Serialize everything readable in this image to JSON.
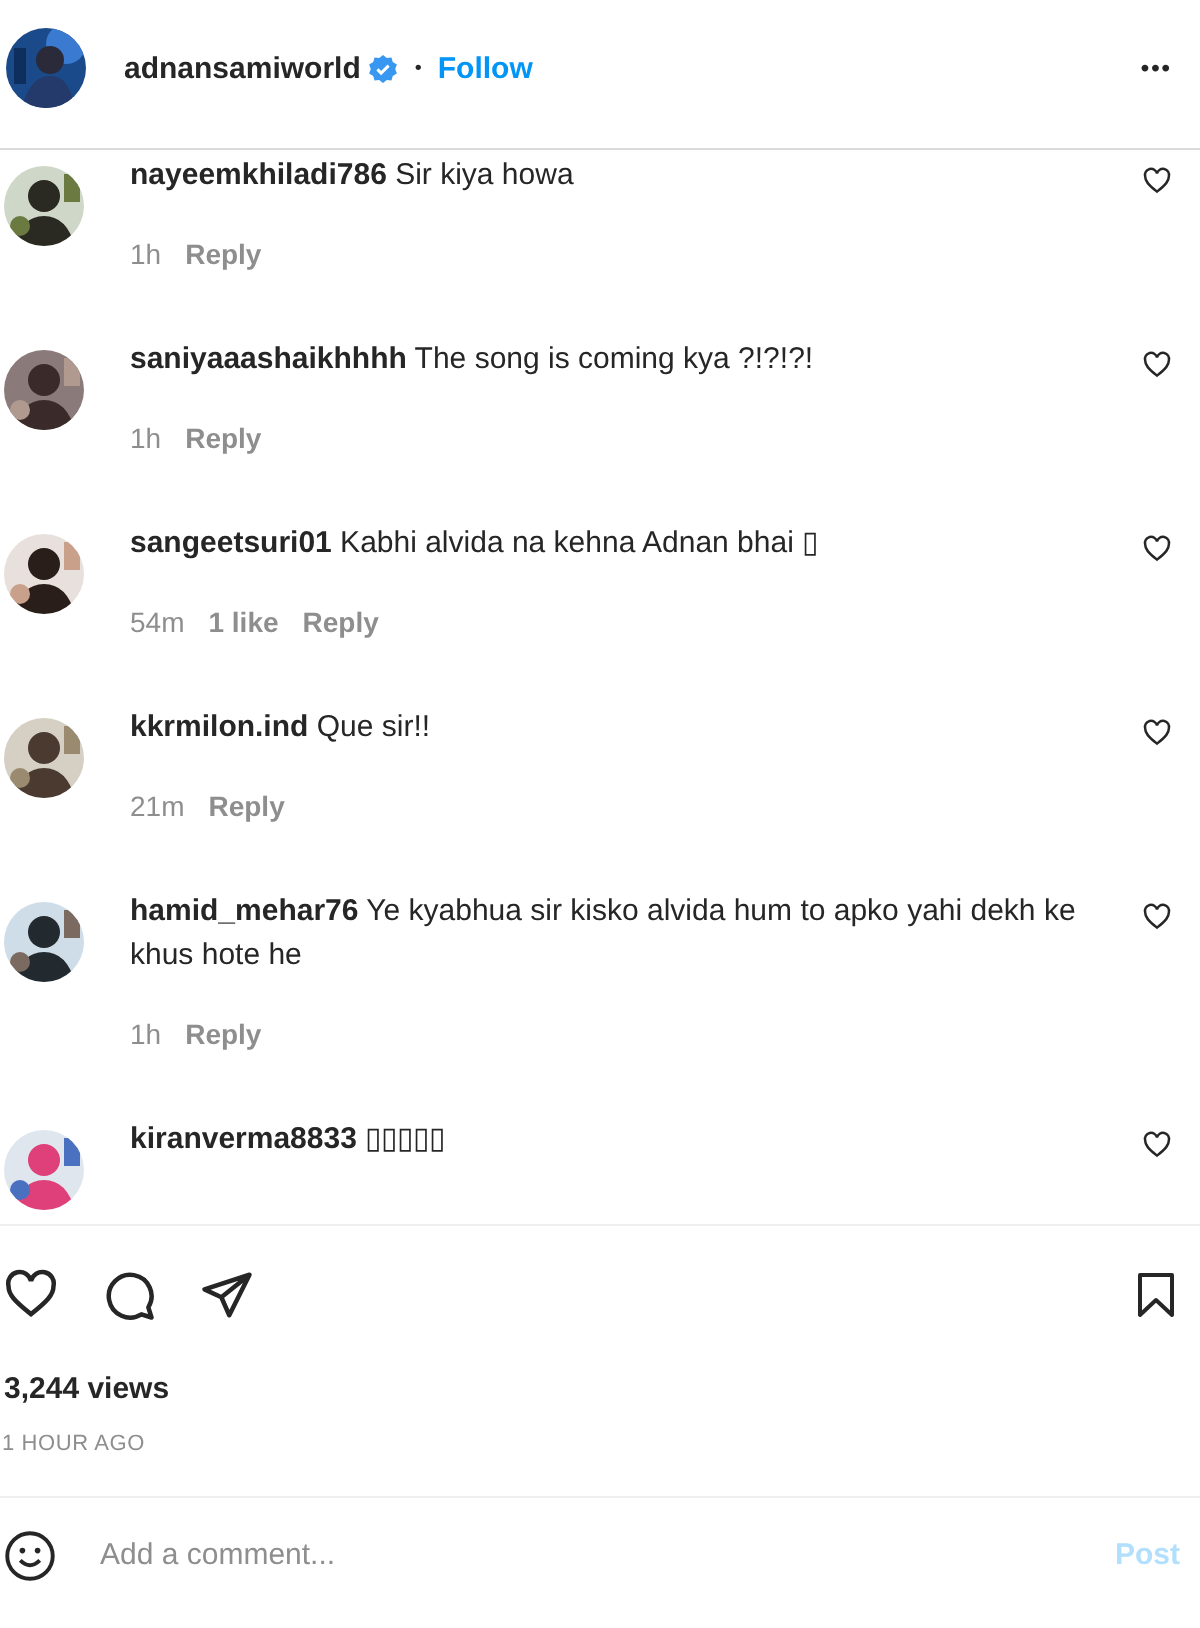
{
  "header": {
    "username": "adnansamiworld",
    "verified": true,
    "separator": "•",
    "follow": "Follow",
    "more": "•••"
  },
  "comments": [
    {
      "username": "nayeemkhiladi786",
      "text": "Sir kiya howa",
      "time": "1h",
      "reply": "Reply"
    },
    {
      "username": "saniyaaashaikhhhh",
      "text": "The song is coming kya ?!?!?!",
      "time": "1h",
      "reply": "Reply"
    },
    {
      "username": "sangeetsuri01",
      "text": "Kabhi alvida na kehna Adnan bhai ▯",
      "time": "54m",
      "likes": "1 like",
      "reply": "Reply"
    },
    {
      "username": "kkrmilon.ind",
      "text": "Que sir!!",
      "time": "21m",
      "reply": "Reply"
    },
    {
      "username": "hamid_mehar76",
      "text": "Ye kyabhua sir kisko alvida hum to apko yahi dekh ke khus hote he",
      "time": "1h",
      "reply": "Reply"
    },
    {
      "username": "kiranverma8833",
      "text": "▯▯▯▯▯"
    }
  ],
  "views": "3,244 views",
  "posted": "1 HOUR AGO",
  "composer": {
    "placeholder": "Add a comment...",
    "post": "Post"
  }
}
